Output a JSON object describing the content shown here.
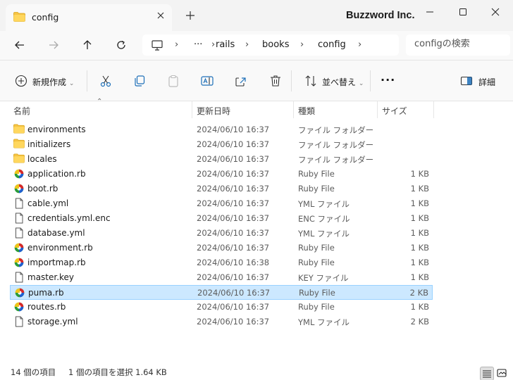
{
  "tab": {
    "title": "config"
  },
  "brand": "Buzzword Inc.",
  "breadcrumb": {
    "ellipsis": "···",
    "items": [
      "rails",
      "books",
      "config"
    ]
  },
  "search": {
    "placeholder": "configの検索"
  },
  "commands": {
    "new": "新規作成",
    "sort": "並べ替え",
    "more": "···",
    "details": "詳細"
  },
  "columns": {
    "name": "名前",
    "date": "更新日時",
    "type": "種類",
    "size": "サイズ"
  },
  "files": [
    {
      "name": "environments",
      "date": "2024/06/10 16:37",
      "type": "ファイル フォルダー",
      "size": "",
      "icon": "folder"
    },
    {
      "name": "initializers",
      "date": "2024/06/10 16:37",
      "type": "ファイル フォルダー",
      "size": "",
      "icon": "folder"
    },
    {
      "name": "locales",
      "date": "2024/06/10 16:37",
      "type": "ファイル フォルダー",
      "size": "",
      "icon": "folder"
    },
    {
      "name": "application.rb",
      "date": "2024/06/10 16:37",
      "type": "Ruby File",
      "size": "1 KB",
      "icon": "ruby"
    },
    {
      "name": "boot.rb",
      "date": "2024/06/10 16:37",
      "type": "Ruby File",
      "size": "1 KB",
      "icon": "ruby"
    },
    {
      "name": "cable.yml",
      "date": "2024/06/10 16:37",
      "type": "YML ファイル",
      "size": "1 KB",
      "icon": "file"
    },
    {
      "name": "credentials.yml.enc",
      "date": "2024/06/10 16:37",
      "type": "ENC ファイル",
      "size": "1 KB",
      "icon": "file"
    },
    {
      "name": "database.yml",
      "date": "2024/06/10 16:37",
      "type": "YML ファイル",
      "size": "1 KB",
      "icon": "file"
    },
    {
      "name": "environment.rb",
      "date": "2024/06/10 16:37",
      "type": "Ruby File",
      "size": "1 KB",
      "icon": "ruby"
    },
    {
      "name": "importmap.rb",
      "date": "2024/06/10 16:38",
      "type": "Ruby File",
      "size": "1 KB",
      "icon": "ruby"
    },
    {
      "name": "master.key",
      "date": "2024/06/10 16:37",
      "type": "KEY ファイル",
      "size": "1 KB",
      "icon": "file"
    },
    {
      "name": "puma.rb",
      "date": "2024/06/10 16:37",
      "type": "Ruby File",
      "size": "2 KB",
      "icon": "ruby",
      "selected": true
    },
    {
      "name": "routes.rb",
      "date": "2024/06/10 16:37",
      "type": "Ruby File",
      "size": "1 KB",
      "icon": "ruby"
    },
    {
      "name": "storage.yml",
      "date": "2024/06/10 16:37",
      "type": "YML ファイル",
      "size": "2 KB",
      "icon": "file"
    }
  ],
  "status": {
    "count": "14 個の項目",
    "selection": "1 個の項目を選択  1.64 KB"
  },
  "colors": {
    "selection_bg": "#cce8ff",
    "selection_border": "#99d1ff",
    "folder": "#f6c445",
    "accent": "#0067c0"
  }
}
